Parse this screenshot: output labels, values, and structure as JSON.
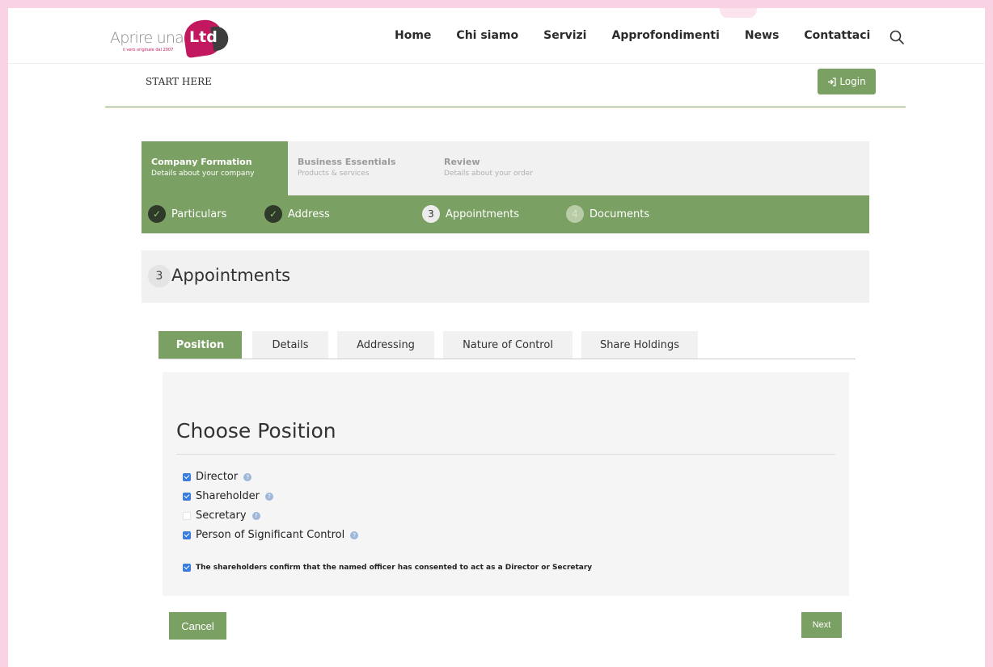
{
  "brand": {
    "logo_text": "Aprire una",
    "logo_badge": "Ltd",
    "logo_tagline": "il vero originale dal 2007"
  },
  "nav": {
    "items": [
      "Home",
      "Chi siamo",
      "Servizi",
      "Approfondimenti",
      "News",
      "Contattaci"
    ],
    "search_icon": "search-icon"
  },
  "subheader": {
    "start_here": "START HERE",
    "login_label": "Login",
    "login_icon": "sign-in-icon"
  },
  "steps": {
    "main": [
      {
        "title": "Company Formation",
        "subtitle": "Details about your company",
        "active": true
      },
      {
        "title": "Business Essentials",
        "subtitle": "Products & services",
        "active": false
      },
      {
        "title": "Review",
        "subtitle": "Details about your order",
        "active": false
      }
    ],
    "sub": [
      {
        "marker": "✓",
        "label": "Particulars",
        "state": "done"
      },
      {
        "marker": "✓",
        "label": "Address",
        "state": "done"
      },
      {
        "marker": "3",
        "label": "Appointments",
        "state": "current"
      },
      {
        "marker": "4",
        "label": "Documents",
        "state": "todo"
      }
    ]
  },
  "section": {
    "number": "3",
    "title": "Appointments"
  },
  "tabs": [
    "Position",
    "Details",
    "Addressing",
    "Nature of Control",
    "Share Holdings"
  ],
  "active_tab": "Position",
  "panel": {
    "title": "Choose Position",
    "options": [
      {
        "label": "Director",
        "checked": true
      },
      {
        "label": "Shareholder",
        "checked": true
      },
      {
        "label": "Secretary",
        "checked": false
      },
      {
        "label": "Person of Significant Control",
        "checked": true
      }
    ],
    "consent": {
      "label": "The shareholders confirm that the named officer has consented to act as a Director or Secretary",
      "checked": true
    }
  },
  "actions": {
    "cancel_label": "Cancel",
    "next_label": "Next"
  },
  "colors": {
    "brand_green": "#7ba063",
    "brand_magenta": "#c1185f",
    "checkbox_blue": "#3b7ddd",
    "page_border_pink": "#f9d3e3"
  }
}
